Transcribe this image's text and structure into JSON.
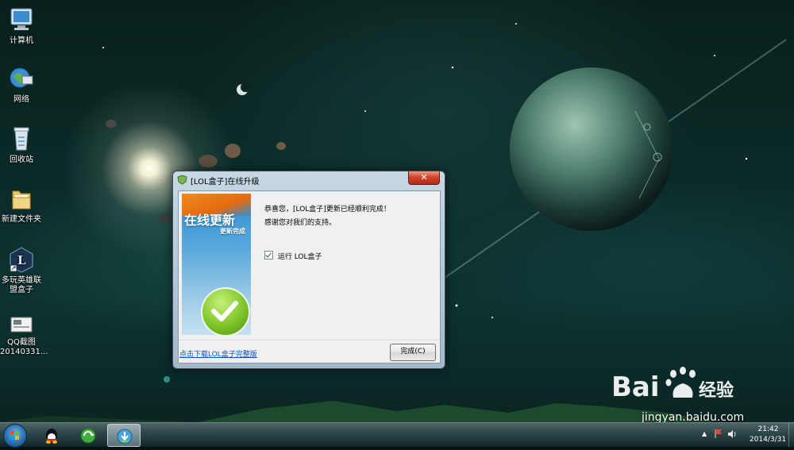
{
  "desktop": {
    "icons": [
      {
        "label": "计算机",
        "icon": "computer-icon"
      },
      {
        "label": "网络",
        "icon": "network-icon"
      },
      {
        "label": "回收站",
        "icon": "recycle-bin-icon"
      },
      {
        "label": "新建文件夹",
        "icon": "folder-icon"
      },
      {
        "label": "多玩英雄联盟盒子",
        "icon": "lol-box-shortcut-icon"
      },
      {
        "label": "QQ截图20140331...",
        "icon": "screenshot-file-icon"
      }
    ]
  },
  "dialog": {
    "title": "[LOL盒子]在线升级",
    "close_label": "✕",
    "banner_title": "在线更新",
    "banner_subtitle": "更新完成",
    "message_line1": "恭喜您，[LOL盒子]更新已经顺利完成！",
    "message_line2": "感谢您对我们的支持。",
    "run_checkbox_label": "运行 LOL盒子",
    "run_checked": true,
    "download_link": "点击下载LOL盒子完整版",
    "finish_button": "完成(C)"
  },
  "taskbar": {
    "pinned": [
      "qq-icon",
      "browser-icon",
      "lol-box-updater-icon"
    ],
    "tray_expand": "▲",
    "time": "21:42",
    "date": "2014/3/31"
  },
  "watermark": {
    "logo_text": "Bai 经验",
    "url": "jingyan.baidu.com"
  }
}
